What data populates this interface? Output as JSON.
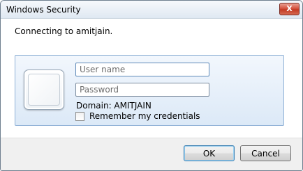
{
  "window": {
    "title": "Windows Security",
    "close_label": "X"
  },
  "message": "Connecting to amitjain.",
  "credentials": {
    "user_tile_icon": "blank-user-tile",
    "username": {
      "value": "",
      "placeholder": "User name"
    },
    "password": {
      "value": "",
      "placeholder": "Password"
    },
    "domain_text": "Domain: AMITJAIN",
    "remember_label": "Remember my credentials",
    "remember_checked": false
  },
  "buttons": {
    "ok_label": "OK",
    "cancel_label": "Cancel"
  },
  "colors": {
    "panel_border": "#8fb1d6",
    "panel_bg_top": "#f2f7fd",
    "panel_bg_bottom": "#dce9f7",
    "close_button": "#c94b36",
    "footer_bg": "#f0f0f0"
  }
}
